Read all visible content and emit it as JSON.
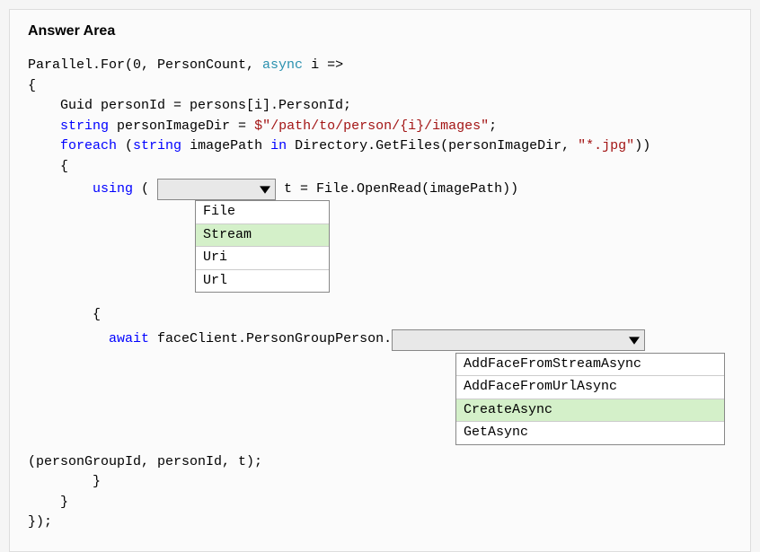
{
  "title": "Answer Area",
  "code": {
    "l1a": "Parallel.For(0, PersonCount, ",
    "l1b": "async",
    "l1c": " i =>",
    "l2": "{",
    "l3a": "    Guid personId = persons[i].PersonId;",
    "l4a": "    ",
    "l4b": "string",
    "l4c": " personImageDir = ",
    "l4d": "$\"/path/to/person/{i}/images\"",
    "l4e": ";",
    "l5a": "    ",
    "l5b": "foreach",
    "l5c": " (",
    "l5d": "string",
    "l5e": " imagePath ",
    "l5f": "in",
    "l5g": " Directory.GetFiles(personImageDir, ",
    "l5h": "\"*.jpg\"",
    "l5i": "))",
    "l6": "    {",
    "l7a": "        ",
    "l7b": "using",
    "l7c": " ( ",
    "l7d": " t = File.OpenRead(imagePath))",
    "l10": "        {",
    "l11a": "          ",
    "l11b": "await",
    "l11c": " faceClient.PersonGroupPerson.",
    "l15": "(personGroupId, personId, t);",
    "l16": "        }",
    "l17": "    }",
    "l18": "});"
  },
  "dropdown1": {
    "options": [
      "File",
      "Stream",
      "Uri",
      "Url"
    ],
    "selected_index": 1
  },
  "dropdown2": {
    "options": [
      "AddFaceFromStreamAsync",
      "AddFaceFromUrlAsync",
      "CreateAsync",
      "GetAsync"
    ],
    "selected_index": 2
  }
}
